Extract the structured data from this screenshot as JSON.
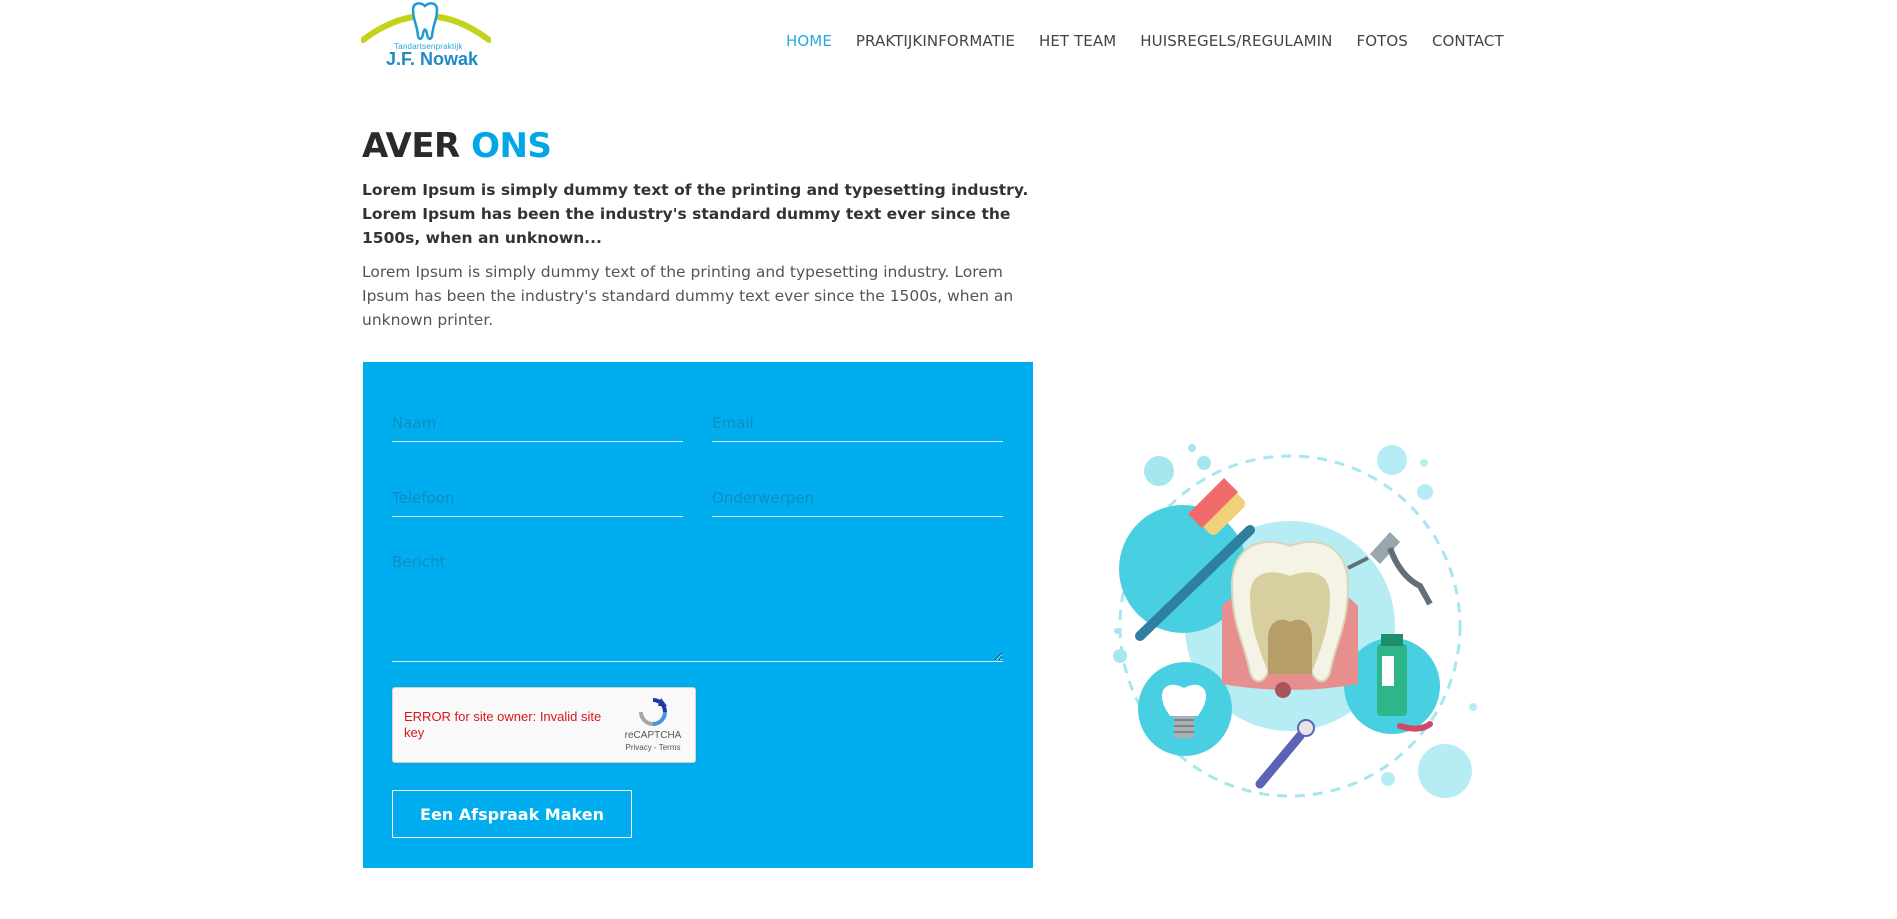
{
  "header": {
    "logo": {
      "subtitle": "Tandartsenpraktijk",
      "name": "J.F. Nowak",
      "colors": {
        "arc": "#c5d21c",
        "tooth": "#1e9bd7",
        "text": "#1f8ac4"
      }
    },
    "nav": [
      {
        "label": "HOME",
        "active": true
      },
      {
        "label": "PRAKTIJKINFORMATIE",
        "active": false
      },
      {
        "label": "HET TEAM",
        "active": false
      },
      {
        "label": "HUISREGELS/REGULAMIN",
        "active": false
      },
      {
        "label": "FOTOS",
        "active": false
      },
      {
        "label": "CONTACT",
        "active": false
      }
    ]
  },
  "about": {
    "title_part1": "AVER",
    "title_part2": "ONS",
    "intro_bold": "Lorem Ipsum is simply dummy text of the printing and typesetting industry. Lorem Ipsum has been the industry's standard dummy text ever since the 1500s, when an unknown...",
    "intro": "Lorem Ipsum is simply dummy text of the printing and typesetting industry. Lorem Ipsum has been the industry's standard dummy text ever since the 1500s, when an unknown printer."
  },
  "form": {
    "name_placeholder": "Naam",
    "email_placeholder": "Email",
    "phone_placeholder": "Telefoon",
    "subject_placeholder": "Onderwerpen",
    "message_placeholder": "Bericht",
    "captcha": {
      "error": "ERROR for site owner: Invalid site key",
      "brand": "reCAPTCHA",
      "links": "Privacy - Terms"
    },
    "submit_label": "Een Afspraak Maken"
  },
  "colors": {
    "accent": "#00adef",
    "nav_active": "#29a8e0",
    "title_dark": "#2a2a2a",
    "captcha_error": "#d9161e"
  },
  "illustration": {
    "icon": "dental-care-illustration"
  }
}
